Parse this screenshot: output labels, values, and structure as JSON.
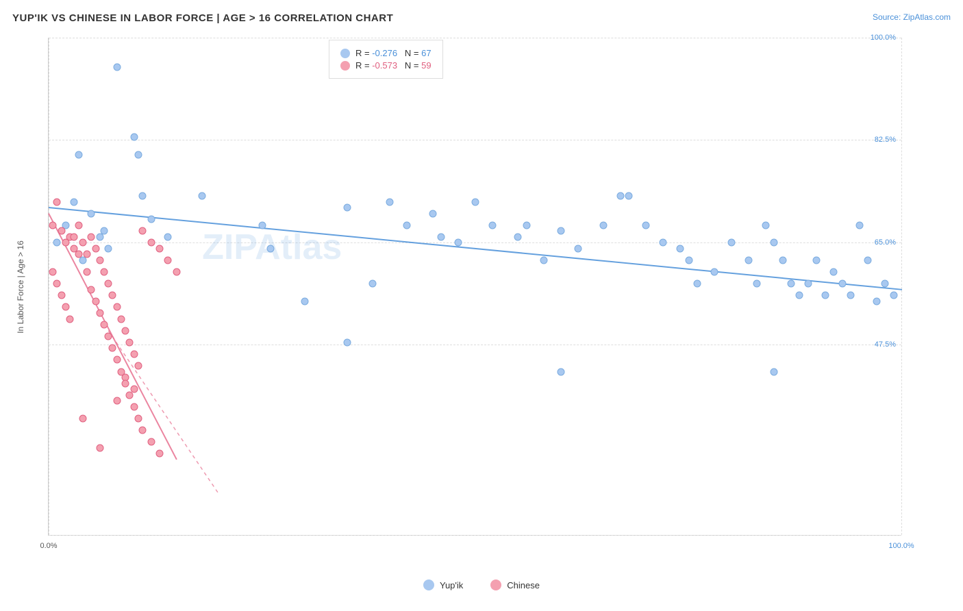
{
  "title": "YUP'IK VS CHINESE IN LABOR FORCE | AGE > 16 CORRELATION CHART",
  "source": "Source: ZipAtlas.com",
  "yAxisLabel": "In Labor Force | Age > 16",
  "legend": {
    "row1": {
      "color": "#a8c8f0",
      "r": "-0.276",
      "n": "67"
    },
    "row2": {
      "color": "#f4a0b0",
      "r": "-0.573",
      "n": "59"
    }
  },
  "yTicks": [
    {
      "label": "100.0%",
      "pct": 100
    },
    {
      "label": "82.5%",
      "pct": 82.5
    },
    {
      "label": "65.0%",
      "pct": 65
    },
    {
      "label": "47.5%",
      "pct": 47.5
    }
  ],
  "xTicks": [
    {
      "label": "0.0%",
      "pct": 0
    },
    {
      "label": "100.0%",
      "pct": 100
    }
  ],
  "watermark": "ZIPAtlas",
  "bottomLegend": [
    {
      "label": "Yup'ik",
      "color": "#a8c8f0"
    },
    {
      "label": "Chinese",
      "color": "#f4a0b0"
    }
  ],
  "bluePoints": [
    [
      1,
      65
    ],
    [
      2,
      68
    ],
    [
      3,
      72
    ],
    [
      3.5,
      80
    ],
    [
      4,
      62
    ],
    [
      5,
      70
    ],
    [
      6,
      66
    ],
    [
      6.5,
      67
    ],
    [
      7,
      64
    ],
    [
      8,
      95
    ],
    [
      10,
      83
    ],
    [
      10.5,
      80
    ],
    [
      11,
      73
    ],
    [
      12,
      69
    ],
    [
      14,
      66
    ],
    [
      18,
      73
    ],
    [
      25,
      68
    ],
    [
      26,
      64
    ],
    [
      30,
      55
    ],
    [
      35,
      71
    ],
    [
      38,
      58
    ],
    [
      40,
      72
    ],
    [
      42,
      68
    ],
    [
      45,
      70
    ],
    [
      46,
      66
    ],
    [
      48,
      65
    ],
    [
      50,
      72
    ],
    [
      52,
      68
    ],
    [
      55,
      66
    ],
    [
      56,
      68
    ],
    [
      58,
      62
    ],
    [
      60,
      67
    ],
    [
      62,
      64
    ],
    [
      65,
      68
    ],
    [
      67,
      73
    ],
    [
      68,
      73
    ],
    [
      70,
      68
    ],
    [
      72,
      65
    ],
    [
      74,
      64
    ],
    [
      75,
      62
    ],
    [
      76,
      58
    ],
    [
      78,
      60
    ],
    [
      80,
      65
    ],
    [
      82,
      62
    ],
    [
      83,
      58
    ],
    [
      84,
      68
    ],
    [
      85,
      65
    ],
    [
      86,
      62
    ],
    [
      87,
      58
    ],
    [
      88,
      56
    ],
    [
      89,
      58
    ],
    [
      90,
      62
    ],
    [
      91,
      56
    ],
    [
      92,
      60
    ],
    [
      93,
      58
    ],
    [
      94,
      56
    ],
    [
      95,
      68
    ],
    [
      96,
      62
    ],
    [
      97,
      55
    ],
    [
      98,
      58
    ],
    [
      99,
      56
    ],
    [
      35,
      48
    ],
    [
      60,
      43
    ],
    [
      85,
      43
    ]
  ],
  "pinkPoints": [
    [
      0.5,
      68
    ],
    [
      1,
      72
    ],
    [
      1.5,
      67
    ],
    [
      2,
      65
    ],
    [
      2.5,
      66
    ],
    [
      3,
      64
    ],
    [
      3.5,
      68
    ],
    [
      4,
      65
    ],
    [
      4.5,
      63
    ],
    [
      5,
      66
    ],
    [
      5.5,
      64
    ],
    [
      6,
      62
    ],
    [
      6.5,
      60
    ],
    [
      7,
      58
    ],
    [
      7.5,
      56
    ],
    [
      8,
      54
    ],
    [
      8.5,
      52
    ],
    [
      9,
      50
    ],
    [
      9.5,
      48
    ],
    [
      10,
      46
    ],
    [
      10.5,
      44
    ],
    [
      11,
      67
    ],
    [
      12,
      65
    ],
    [
      13,
      64
    ],
    [
      4,
      35
    ],
    [
      6,
      30
    ],
    [
      8,
      38
    ],
    [
      9,
      42
    ],
    [
      10,
      40
    ],
    [
      0.5,
      60
    ],
    [
      1,
      58
    ],
    [
      1.5,
      56
    ],
    [
      2,
      54
    ],
    [
      2.5,
      52
    ],
    [
      3,
      66
    ],
    [
      3.5,
      63
    ],
    [
      4.5,
      60
    ],
    [
      5,
      57
    ],
    [
      5.5,
      55
    ],
    [
      6,
      53
    ],
    [
      6.5,
      51
    ],
    [
      7,
      49
    ],
    [
      7.5,
      47
    ],
    [
      8,
      45
    ],
    [
      8.5,
      43
    ],
    [
      9,
      41
    ],
    [
      9.5,
      39
    ],
    [
      10,
      37
    ],
    [
      10.5,
      35
    ],
    [
      11,
      33
    ],
    [
      12,
      31
    ],
    [
      13,
      29
    ],
    [
      14,
      62
    ],
    [
      15,
      60
    ]
  ],
  "blueTrendLine": {
    "x1pct": 0,
    "y1pct": 71,
    "x2pct": 100,
    "y2pct": 57
  },
  "pinkTrendLine": {
    "x1pct": 0,
    "y1pct": 70,
    "x2pct": 15,
    "y2pct": 28
  },
  "pinkDashedLine": {
    "x1pct": 7,
    "y1pct": 50,
    "x2pct": 20,
    "y2pct": 22
  }
}
